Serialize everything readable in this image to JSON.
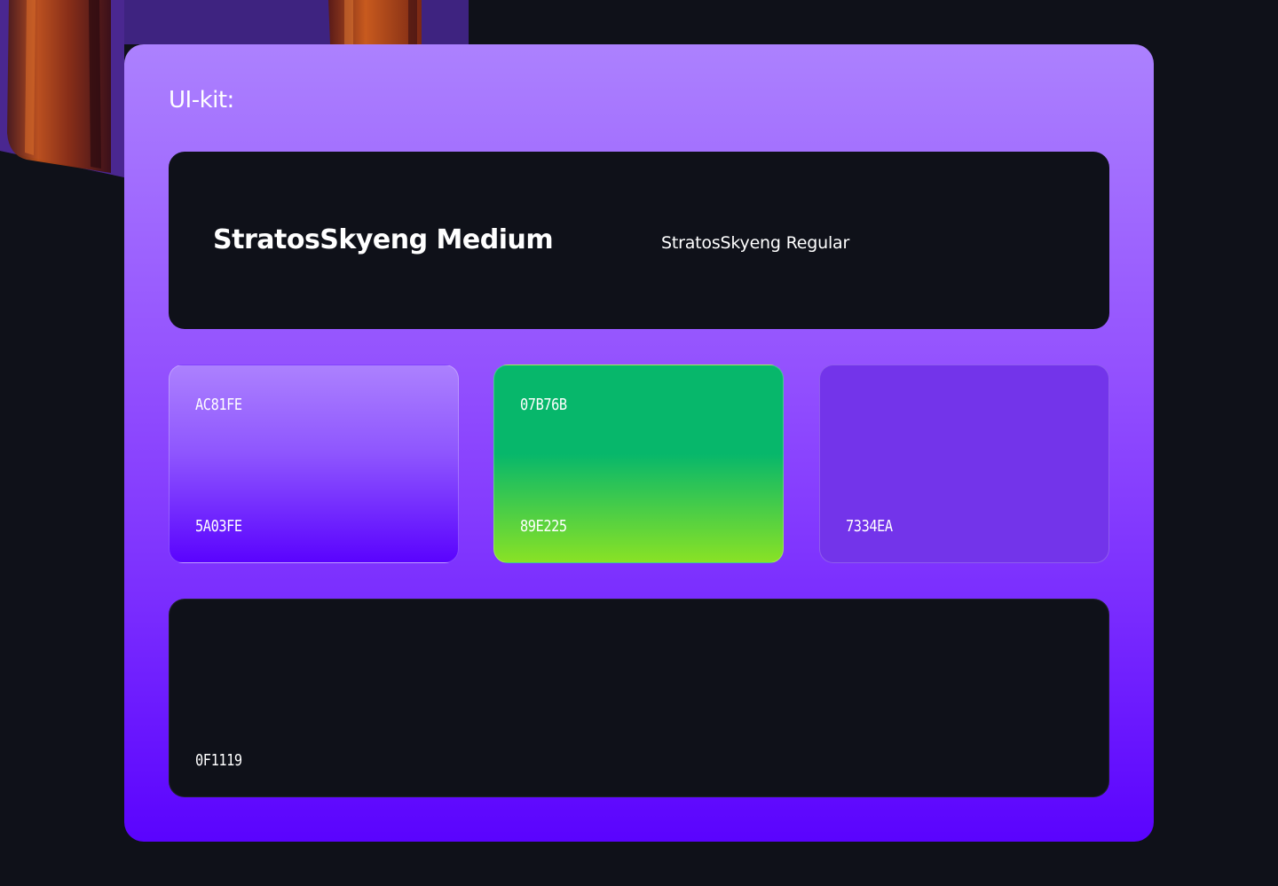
{
  "panel": {
    "title": "UI-kit:"
  },
  "fonts": {
    "medium_label": "StratosSkyeng Medium",
    "regular_label": "StratosSkyeng Regular"
  },
  "swatches": [
    {
      "top_hex": "AC81FE",
      "bottom_hex": "5A03FE",
      "colors": [
        "#AC81FE",
        "#5A03FE"
      ]
    },
    {
      "top_hex": "07B76B",
      "bottom_hex": "89E225",
      "colors": [
        "#07B76B",
        "#89E225"
      ]
    },
    {
      "bottom_hex": "7334EA",
      "colors": [
        "#7334EA"
      ]
    }
  ],
  "dark_card": {
    "hex": "0F1119",
    "color": "#0F1119"
  },
  "colors": {
    "background": "#0F1119",
    "accent_purple": "#AC81FE",
    "deep_purple": "#5A03FE",
    "green": "#07B76B",
    "lime": "#89E225",
    "violet": "#7334EA"
  }
}
